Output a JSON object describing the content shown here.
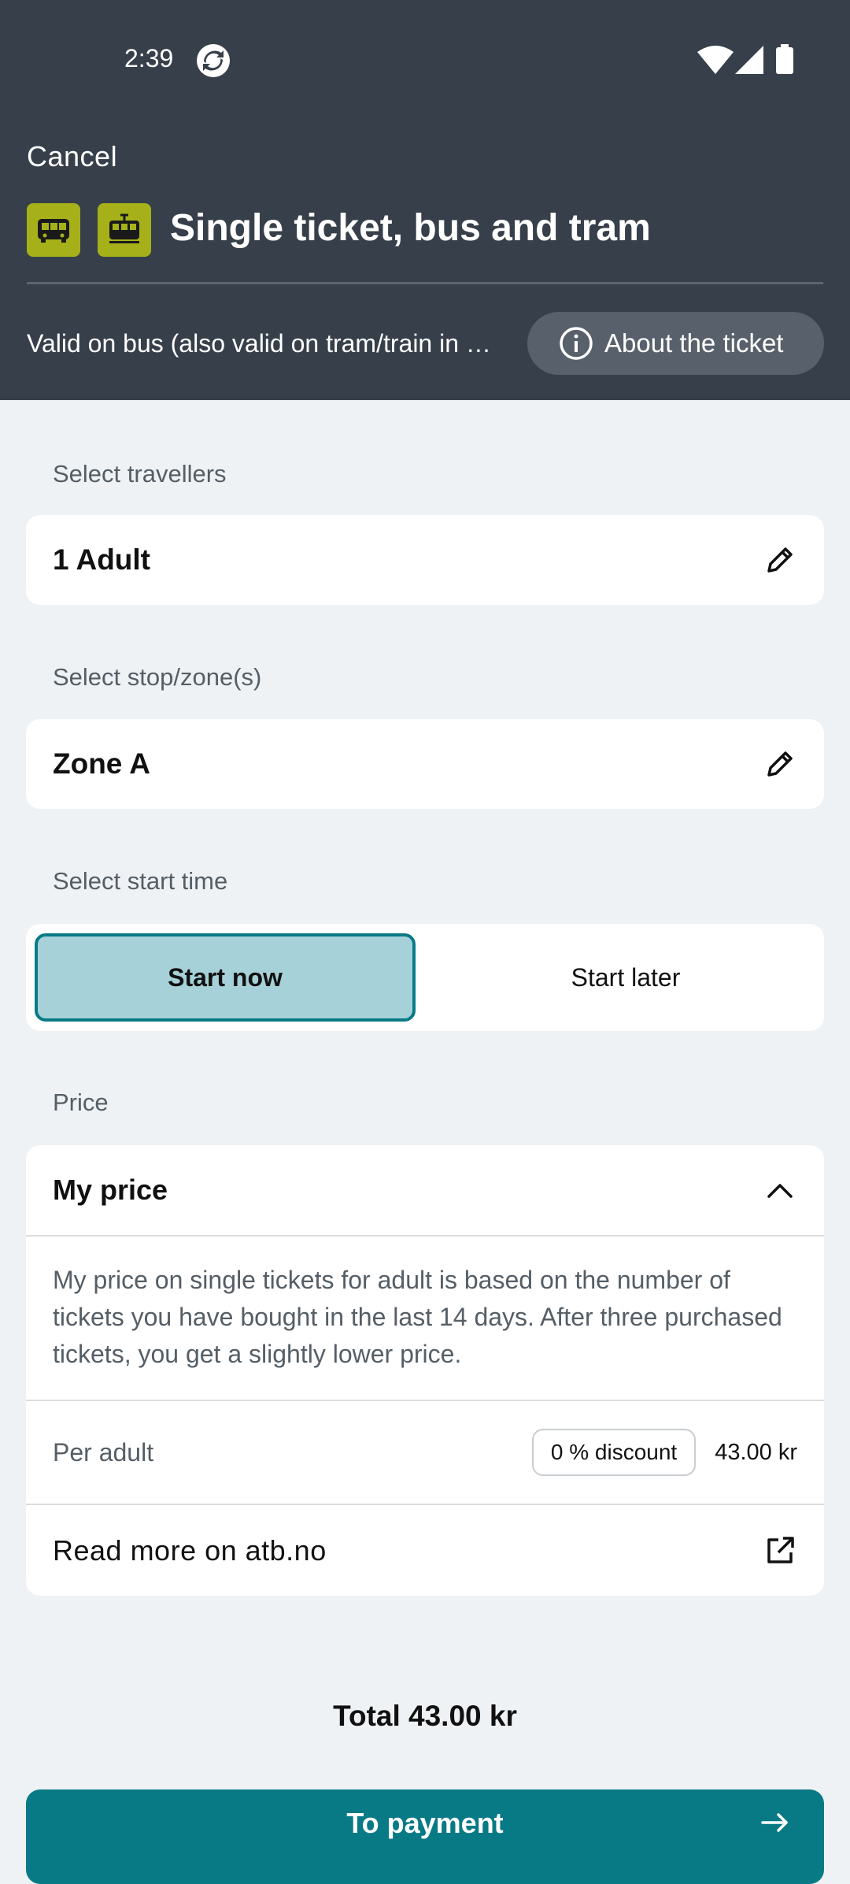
{
  "status_bar": {
    "time": "2:39"
  },
  "header": {
    "cancel_label": "Cancel",
    "title": "Single ticket, bus and tram",
    "valid_text": "Valid on bus (also valid on tram/train in zone A)",
    "about_label": "About the ticket",
    "mode_icons": [
      "bus-icon",
      "tram-icon"
    ],
    "mode_icon_color": "#a6b11a"
  },
  "travellers": {
    "label": "Select travellers",
    "value": "1 Adult"
  },
  "zones": {
    "label": "Select stop/zone(s)",
    "value": "Zone A"
  },
  "start_time": {
    "label": "Select start time",
    "options": [
      "Start now",
      "Start later"
    ],
    "selected": "Start now"
  },
  "price": {
    "label": "Price",
    "title": "My price",
    "description": "My price on single tickets for adult is based on the number of tickets you have bought in the last 14 days. After three purchased tickets, you get a slightly lower price.",
    "per_adult_label": "Per adult",
    "discount_badge": "0 % discount",
    "amount": "43.00 kr",
    "read_more": "Read more on atb.no"
  },
  "footer": {
    "total": "Total 43.00 kr",
    "pay_label": "To payment",
    "accent_color": "#087a86"
  }
}
